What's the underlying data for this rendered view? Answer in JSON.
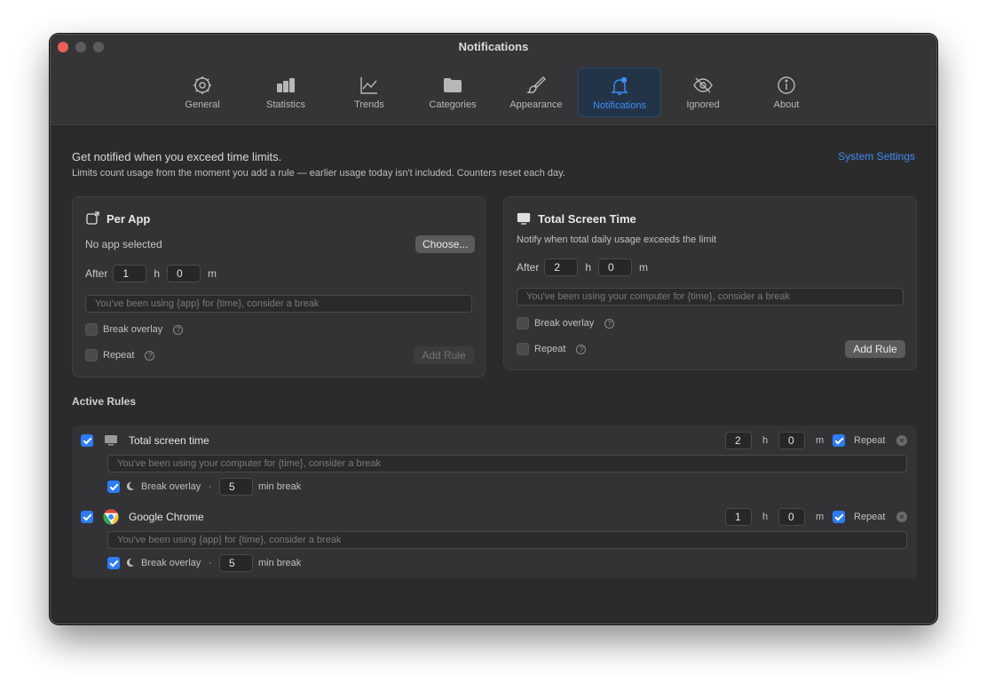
{
  "window": {
    "title": "Notifications"
  },
  "tabs": [
    {
      "label": "General",
      "icon": "gear-icon"
    },
    {
      "label": "Statistics",
      "icon": "bar-chart-icon"
    },
    {
      "label": "Trends",
      "icon": "line-chart-icon"
    },
    {
      "label": "Categories",
      "icon": "folder-icon"
    },
    {
      "label": "Appearance",
      "icon": "paintbrush-icon"
    },
    {
      "label": "Notifications",
      "icon": "bell-icon",
      "active": true
    },
    {
      "label": "Ignored",
      "icon": "eye-slash-icon"
    },
    {
      "label": "About",
      "icon": "info-icon"
    }
  ],
  "intro": {
    "title": "Get notified when you exceed time limits.",
    "subtitle": "Limits count usage from the moment you add a rule — earlier usage today isn't included. Counters reset each day.",
    "system_settings": "System Settings"
  },
  "per_app": {
    "title": "Per App",
    "no_app": "No app selected",
    "choose": "Choose...",
    "after": "After",
    "hours": "1",
    "h": "h",
    "minutes": "0",
    "m": "m",
    "placeholder": "You've been using {app} for {time}, consider a break",
    "break_overlay": "Break overlay",
    "repeat": "Repeat",
    "add_rule": "Add Rule"
  },
  "total": {
    "title": "Total Screen Time",
    "desc": "Notify when total daily usage exceeds the limit",
    "after": "After",
    "hours": "2",
    "h": "h",
    "minutes": "0",
    "m": "m",
    "placeholder": "You've been using your computer for {time}, consider a break",
    "break_overlay": "Break overlay",
    "repeat": "Repeat",
    "add_rule": "Add Rule"
  },
  "active_rules": {
    "title": "Active Rules",
    "rules": [
      {
        "name": "Total screen time",
        "hours": "2",
        "h": "h",
        "minutes": "0",
        "m": "m",
        "repeat": "Repeat",
        "message": "You've been using your computer for {time}, consider a break",
        "break_overlay": "Break overlay",
        "dot": "·",
        "break_minutes": "5",
        "min_break": "min break"
      },
      {
        "name": "Google Chrome",
        "hours": "1",
        "h": "h",
        "minutes": "0",
        "m": "m",
        "repeat": "Repeat",
        "message": "You've been using {app} for {time}, consider a break",
        "break_overlay": "Break overlay",
        "dot": "·",
        "break_minutes": "5",
        "min_break": "min break"
      }
    ]
  },
  "colors": {
    "accent": "#3d8ef7",
    "window_bg": "#2b2b2c",
    "checkbox_on": "#2d7cf6"
  }
}
